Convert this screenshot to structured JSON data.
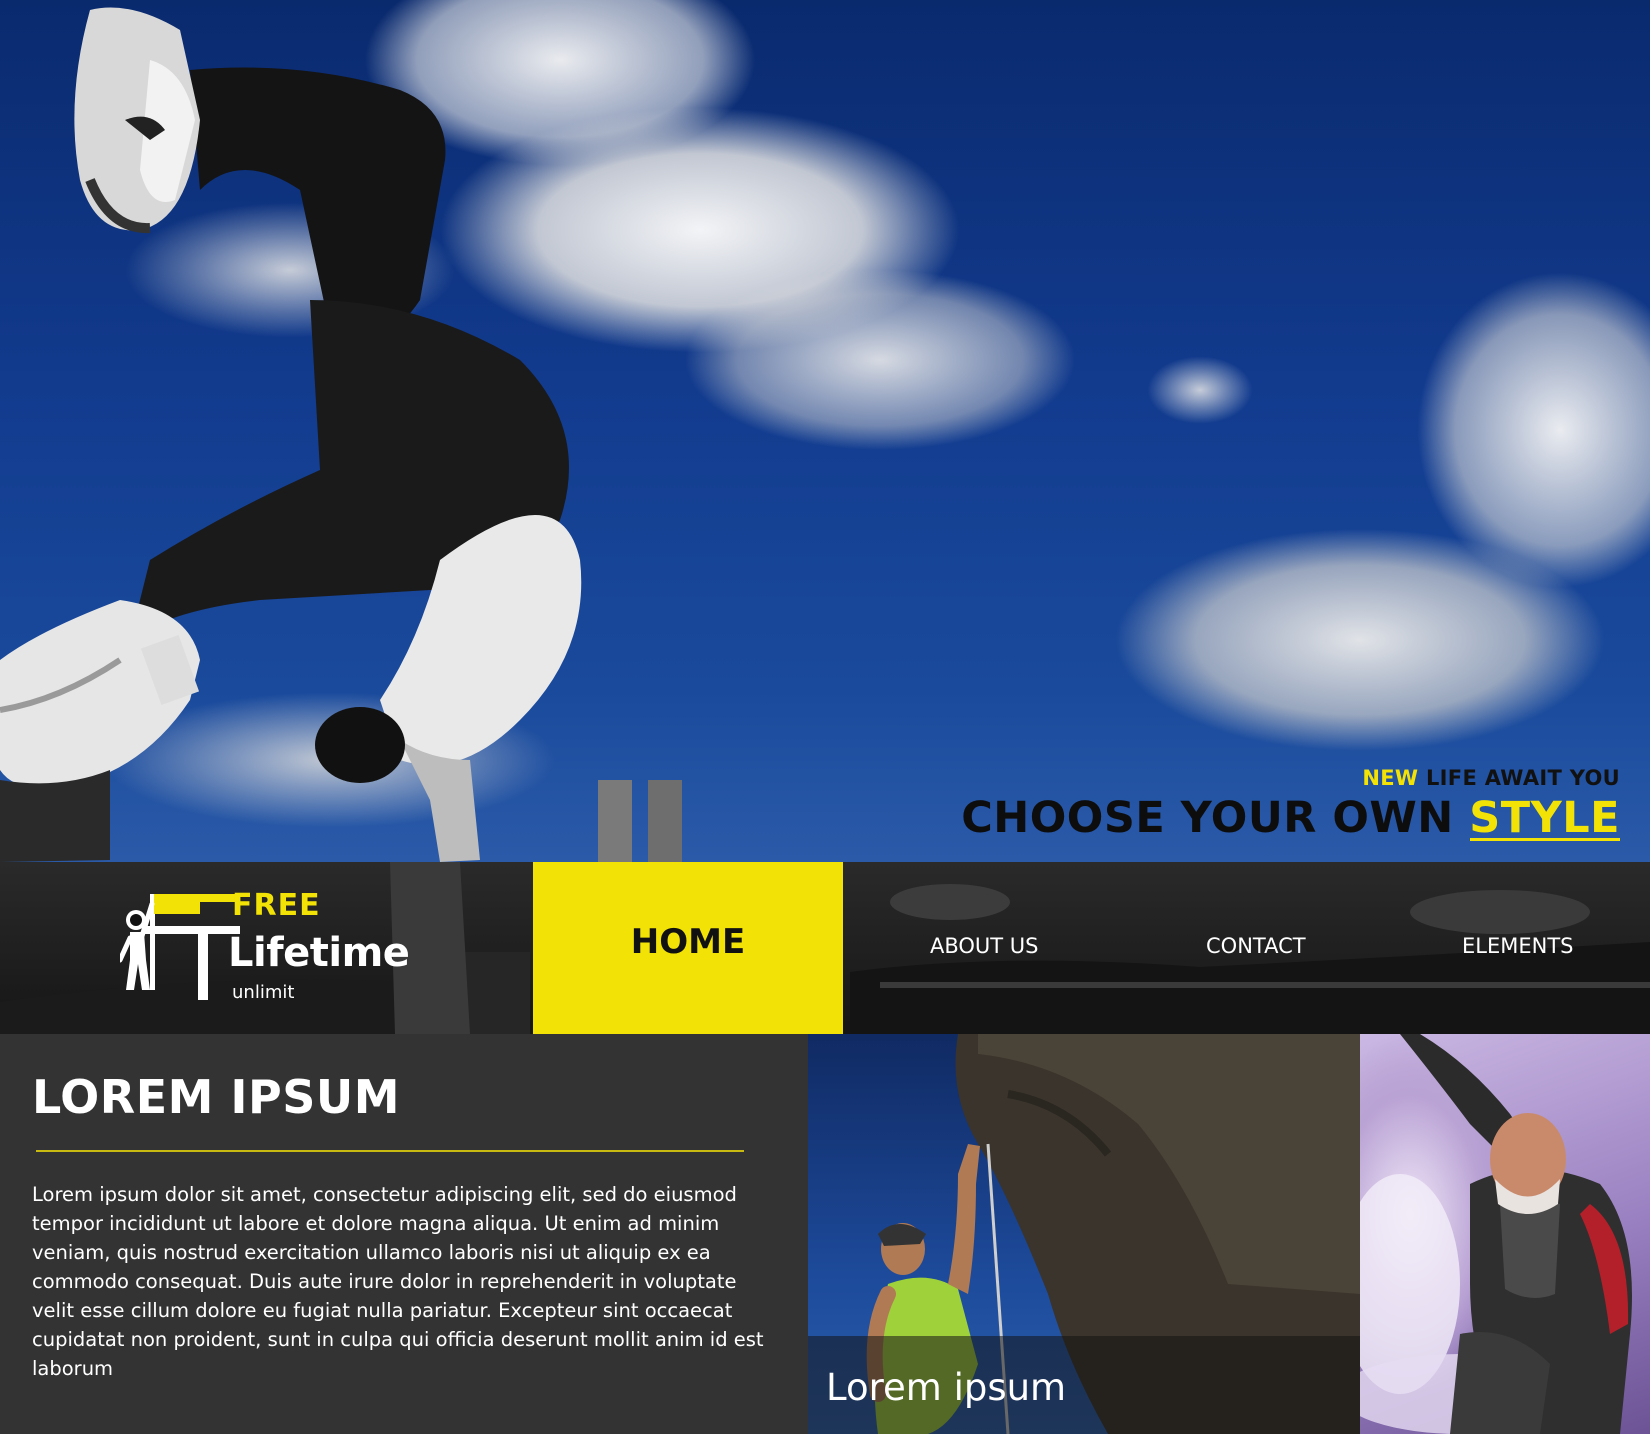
{
  "hero": {
    "tagline_accent": "NEW",
    "tagline_rest": " LIFE AWAIT YOU",
    "headline_main": "CHOOSE YOUR OWN ",
    "headline_accent": "STYLE"
  },
  "logo": {
    "free": "FREE",
    "lifetime": "Lifetime",
    "unlimit": "unlimit"
  },
  "nav": {
    "home": "HOME",
    "about": "ABOUT US",
    "contact": "CONTACT",
    "elements": "ELEMENTS"
  },
  "article": {
    "title": "LOREM IPSUM",
    "body": "Lorem ipsum dolor sit amet, consectetur adipiscing elit, sed do eiusmod tempor incididunt ut labore et dolore magna aliqua. Ut enim ad minim veniam, quis nostrud exercitation ullamco laboris nisi ut aliquip ex ea commodo consequat. Duis aute irure dolor in reprehenderit in voluptate velit esse cillum dolore eu fugiat nulla pariatur. Excepteur sint occaecat cupidatat non proident, sunt in culpa qui officia deserunt mollit anim id est laborum"
  },
  "cards": {
    "climb_caption": "Lorem ipsum"
  },
  "colors": {
    "accent": "#f2e205",
    "dark_panel": "#333333",
    "sky": "#123b8e"
  },
  "icons": {
    "logo": "climber-flag-logo-icon"
  }
}
